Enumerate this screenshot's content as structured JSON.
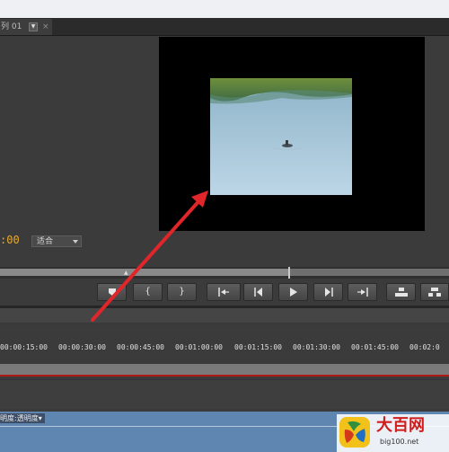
{
  "tab": {
    "label": "列 01",
    "close": "×"
  },
  "monitor": {
    "timecode": ":00",
    "fit_label": "适合"
  },
  "ruler": {
    "labels": [
      "00:00:15:00",
      "00:00:30:00",
      "00:00:45:00",
      "00:01:00:00",
      "00:01:15:00",
      "00:01:30:00",
      "00:01:45:00",
      "00:02:0"
    ]
  },
  "track": {
    "label": "明度:透明度▾"
  },
  "watermark": {
    "name": "大百网",
    "url": "big100.net"
  },
  "transport": {
    "marker": "marker-icon",
    "in_point": "{",
    "out_point": "}",
    "go_to_in": "go-to-in-icon",
    "step_back": "step-back-icon",
    "play": "play-icon",
    "step_forward": "step-forward-icon",
    "go_to_out": "go-to-out-icon",
    "insert": "insert-icon",
    "overlay": "overlay-icon"
  },
  "colors": {
    "timecode": "#e9a82a",
    "annotation_arrow": "#e0262a",
    "playhead_line": "#b01818"
  }
}
